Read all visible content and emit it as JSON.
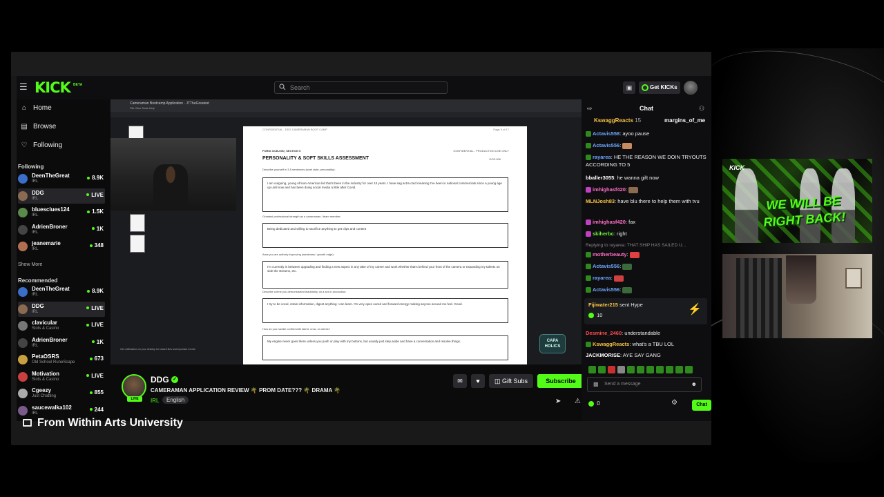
{
  "header": {
    "logo": "KICK",
    "logo_beta": "BETA",
    "search_placeholder": "Search",
    "get_kicks": "Get KICKs"
  },
  "sidebar": {
    "nav": [
      {
        "label": "Home",
        "icon": "home-icon"
      },
      {
        "label": "Browse",
        "icon": "browse-icon"
      },
      {
        "label": "Following",
        "icon": "heart-icon"
      }
    ],
    "following_title": "Following",
    "following": [
      {
        "name": "DeenTheGreat",
        "category": "IRL",
        "count": "8.9K",
        "color": "#3a6ec8"
      },
      {
        "name": "DDG",
        "category": "IRL",
        "count": "LIVE",
        "color": "#8a6a50"
      },
      {
        "name": "bluesclues124",
        "category": "IRL",
        "count": "1.5K",
        "color": "#5a8a4a"
      },
      {
        "name": "AdrienBroner",
        "category": "IRL",
        "count": "1K",
        "color": "#444"
      },
      {
        "name": "jeanemarie",
        "category": "IRL",
        "count": "348",
        "color": "#b07050"
      }
    ],
    "show_more": "Show More",
    "recommended_title": "Recommended",
    "recommended": [
      {
        "name": "DeenTheGreat",
        "category": "IRL",
        "count": "8.9K",
        "color": "#3a6ec8"
      },
      {
        "name": "DDG",
        "category": "IRL",
        "count": "LIVE",
        "color": "#8a6a50"
      },
      {
        "name": "clavicular",
        "category": "Slots & Casino",
        "count": "LIVE",
        "color": "#777"
      },
      {
        "name": "AdrienBroner",
        "category": "IRL",
        "count": "1K",
        "color": "#444"
      },
      {
        "name": "PetaOSRS",
        "category": "Old School RuneScape",
        "count": "673",
        "color": "#c8a040"
      },
      {
        "name": "Motivation",
        "category": "Slots & Casino",
        "count": "LIVE",
        "color": "#c84040"
      },
      {
        "name": "Cgeezy",
        "category": "Just Chatting",
        "count": "855",
        "color": "#aaa"
      },
      {
        "name": "saucewalka102",
        "category": "IRL",
        "count": "244",
        "color": "#7a5a8a"
      }
    ]
  },
  "document": {
    "window_title": "Cameraman Bootcamp Application · JTTheGreatest",
    "menu": "File  View  Tools  Help",
    "confidential": "CONFIDENTIAL - DDG CAMERAMAN BOOT CAMP",
    "page_no": "Page 5 of 17",
    "form": "FORM: DCB-006 | SECTION 5",
    "production": "CONFIDENTIAL - PRODUCTION USE ONLY",
    "heading": "PERSONALITY & SOFT SKILLS ASSESSMENT",
    "code": "DCB-006",
    "questions": [
      {
        "q": "Describe yourself in 3-5 sentences (work style, personality):",
        "a": "I am outgoing, young African American kid that's been in the industry for over 10 years. I have sag actra card meaning I've been in national commercials since a young age up until now and has been doing social media a little after Covid."
      },
      {
        "q": "Greatest professional strength as a cameraman / team member:",
        "a": "Being dedicated and willing to sacrifice anything to get clips and content"
      },
      {
        "q": "Area you are actively improving (weakness / growth edge):",
        "a": "I'm currently in between upgrading and finding a new aspect in any take of my career and work whether that's behind your front of the camera or expanding my talents on side the streams, etc."
      },
      {
        "q": "Describe a time you demonstrated leadership on a set or production:",
        "a": "I try to be vocal, retain information, digest anything I can learn. I'm very open eared and forward energy making anyone around me feel. Good."
      },
      {
        "q": "How do you handle conflict with talent, crew, or clients?",
        "a": "My engine never goes there unless you push or play with my buttons, but usually just step aside and have a conversation and resolve things."
      }
    ],
    "sticker": "CAPA HOLICS",
    "notify": "Get notifications on your desktop for shared files and important events"
  },
  "stream": {
    "name": "DDG",
    "title": "CAMERAMAN APPLICATION REVIEW 🌴 PROM DATE??? 🌴 DRAMA 🌴",
    "category": "IRL",
    "language": "English",
    "live": "LIVE",
    "gift_subs": "Gift Subs",
    "subscribe": "Subscribe"
  },
  "chat": {
    "title": "Chat",
    "pinned_1": "KswaggReacts",
    "pinned_1_count": "15",
    "pinned_2": "margins_of_me",
    "messages": [
      {
        "user": "Actavis558",
        "text": "ayoo pause",
        "cls": "u-blue",
        "badge": "#2f8a1e"
      },
      {
        "user": "Actavis556",
        "text": "",
        "cls": "u-blue",
        "badge": "#2f8a1e",
        "emote": "#c88a60"
      },
      {
        "user": "rayarea",
        "text": "HE THE REASON WE DOIN TRYOUTS ACCORDING TO 5",
        "cls": "u-blue",
        "badge": "#2f8a1e"
      },
      {
        "user": "bballer3055",
        "text": "he wanna gift now",
        "cls": "u-white",
        "badge": ""
      },
      {
        "user": "imhighasf420",
        "text": "",
        "cls": "u-pink",
        "badge": "#c040c0",
        "emote": "#8a6a50"
      },
      {
        "user": "MLNJosh83",
        "text": "have blu there to help them with tvu",
        "cls": "u-gold",
        "badge": ""
      },
      {
        "user": "imhighasf420",
        "text": "fax",
        "cls": "u-pink",
        "badge": "#c040c0"
      },
      {
        "user": "skiherbc",
        "text": "right",
        "cls": "u-green",
        "badge": "#c040c0"
      },
      {
        "user": "Replying to rayarea:",
        "text": "THAT SHIP HAS SAILED U...",
        "cls": "reply",
        "badge": ""
      },
      {
        "user": "motherbeauty",
        "text": "",
        "cls": "u-pink",
        "badge": "#2f8a1e",
        "emote": "#e04040"
      },
      {
        "user": "Actavis556",
        "text": "",
        "cls": "u-blue",
        "badge": "#2f8a1e",
        "emote": "#3a6a3a"
      },
      {
        "user": "rayarea",
        "text": "",
        "cls": "u-blue",
        "badge": "#2f8a1e",
        "emote": "#d04040"
      },
      {
        "user": "Actavis556",
        "text": "",
        "cls": "u-blue",
        "badge": "#2f8a1e",
        "emote": "#3a6a3a"
      }
    ],
    "gift_user": "Fijiwater215",
    "gift_text": "sent Hype",
    "gift_amount": "10",
    "after": [
      {
        "user": "Desmine_2460",
        "text": "understandable",
        "cls": "u-red",
        "badge": ""
      },
      {
        "user": "KswaggReacts",
        "text": "what's a TBU LOL",
        "cls": "u-gold",
        "badge": "#2f8a1e"
      },
      {
        "user": "JACKMORISE",
        "text": "AYE SAY GANG",
        "cls": "u-white",
        "badge": ""
      }
    ],
    "input_placeholder": "Send a message",
    "kicks_count": "0",
    "chat_button": "Chat"
  },
  "caption": "From Within Arts University",
  "overlay": {
    "brb_logo": "KICK",
    "brb_text": "WE WILL BE RIGHT BACK!"
  },
  "colors": {
    "accent": "#53fc18",
    "bg": "#0b0b0c"
  }
}
